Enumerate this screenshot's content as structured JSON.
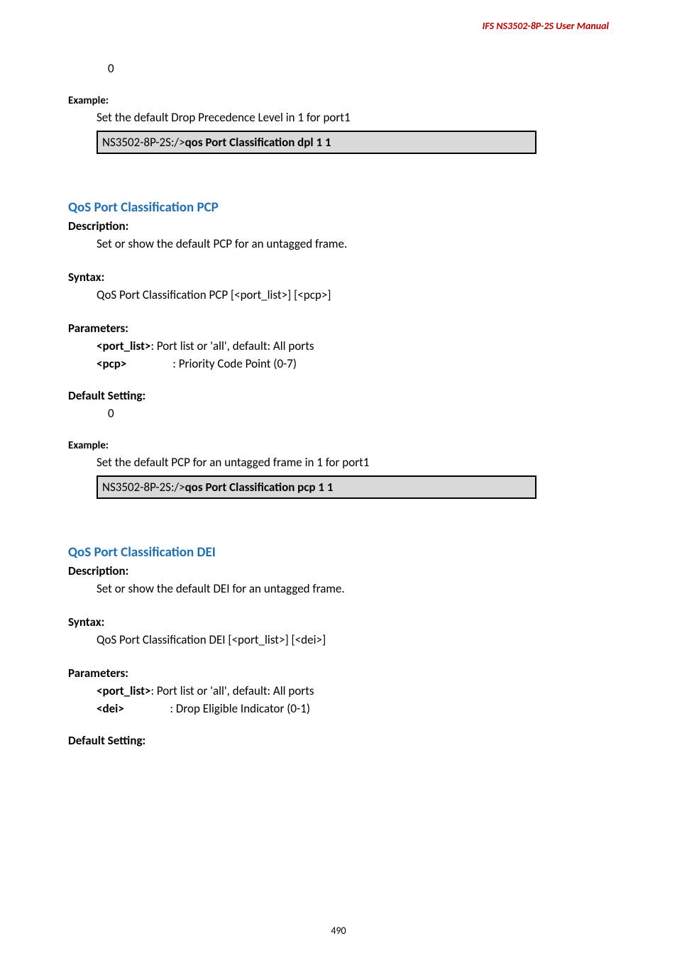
{
  "header": {
    "right": "IFS  NS3502-8P-2S  User  Manual"
  },
  "top": {
    "zero": "0",
    "example_label": "Example:",
    "example_text": "Set the default Drop Precedence Level in 1 for port1",
    "code_prefix": "NS3502-8P-2S:/>",
    "code_cmd": "qos Port Classification dpl 1 1"
  },
  "sec1": {
    "title": "QoS Port Classification PCP",
    "description_label": "Description:",
    "description_text": "Set or show the default PCP for an untagged frame.",
    "syntax_label": "Syntax:",
    "syntax_text": "QoS Port Classification PCP [<port_list>] [<pcp>]",
    "params_label": "Parameters:",
    "param1_name": "<port_list>",
    "param1_desc": ": Port list or 'all', default: All ports",
    "param2_name": "<pcp>",
    "param2_desc": ": Priority Code Point (0-7)",
    "default_label": "Default Setting:",
    "default_value": "0",
    "example_label": "Example:",
    "example_text": "Set the default PCP for an untagged frame in 1 for port1",
    "code_prefix": "NS3502-8P-2S:/>",
    "code_cmd": "qos Port Classification pcp 1 1"
  },
  "sec2": {
    "title": "QoS Port Classification DEI",
    "description_label": "Description:",
    "description_text": "Set or show the default DEI for an untagged frame.",
    "syntax_label": "Syntax:",
    "syntax_text": "QoS Port Classification DEI [<port_list>] [<dei>]",
    "params_label": "Parameters:",
    "param1_name": "<port_list>",
    "param1_desc": ": Port list or 'all', default: All ports",
    "param2_name": "<dei>",
    "param2_desc": ": Drop Eligible Indicator (0-1)",
    "default_label": "Default Setting:"
  },
  "footer": {
    "page": "490"
  }
}
